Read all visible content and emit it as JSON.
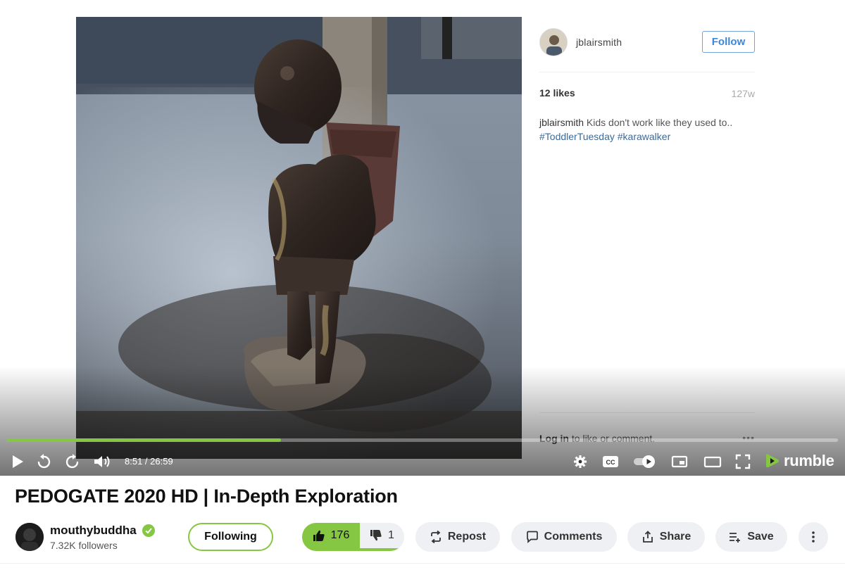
{
  "instagram_post": {
    "username": "jblairsmith",
    "follow_label": "Follow",
    "likes": "12 likes",
    "time_ago": "127w",
    "caption_user": "jblairsmith",
    "caption_text": "Kids don't work like they used to..",
    "caption_tags": "#ToddlerTuesday #karawalker",
    "login_link": "Log in",
    "login_rest": "to like or comment.",
    "more": "•••"
  },
  "player": {
    "progress": 0.33,
    "time": "8:51 / 26:59",
    "brand": "rumble",
    "accent_color": "#85c742"
  },
  "video": {
    "title": "PEDOGATE 2020 HD | In-Depth Exploration"
  },
  "channel": {
    "name": "mouthybuddha",
    "followers": "7.32K followers",
    "verified_icon": "verified-check-icon"
  },
  "actions": {
    "following_label": "Following",
    "upvotes": "176",
    "downvotes": "1",
    "vote_ratio": 0.99,
    "repost_label": "Repost",
    "comments_label": "Comments",
    "share_label": "Share",
    "save_label": "Save"
  }
}
